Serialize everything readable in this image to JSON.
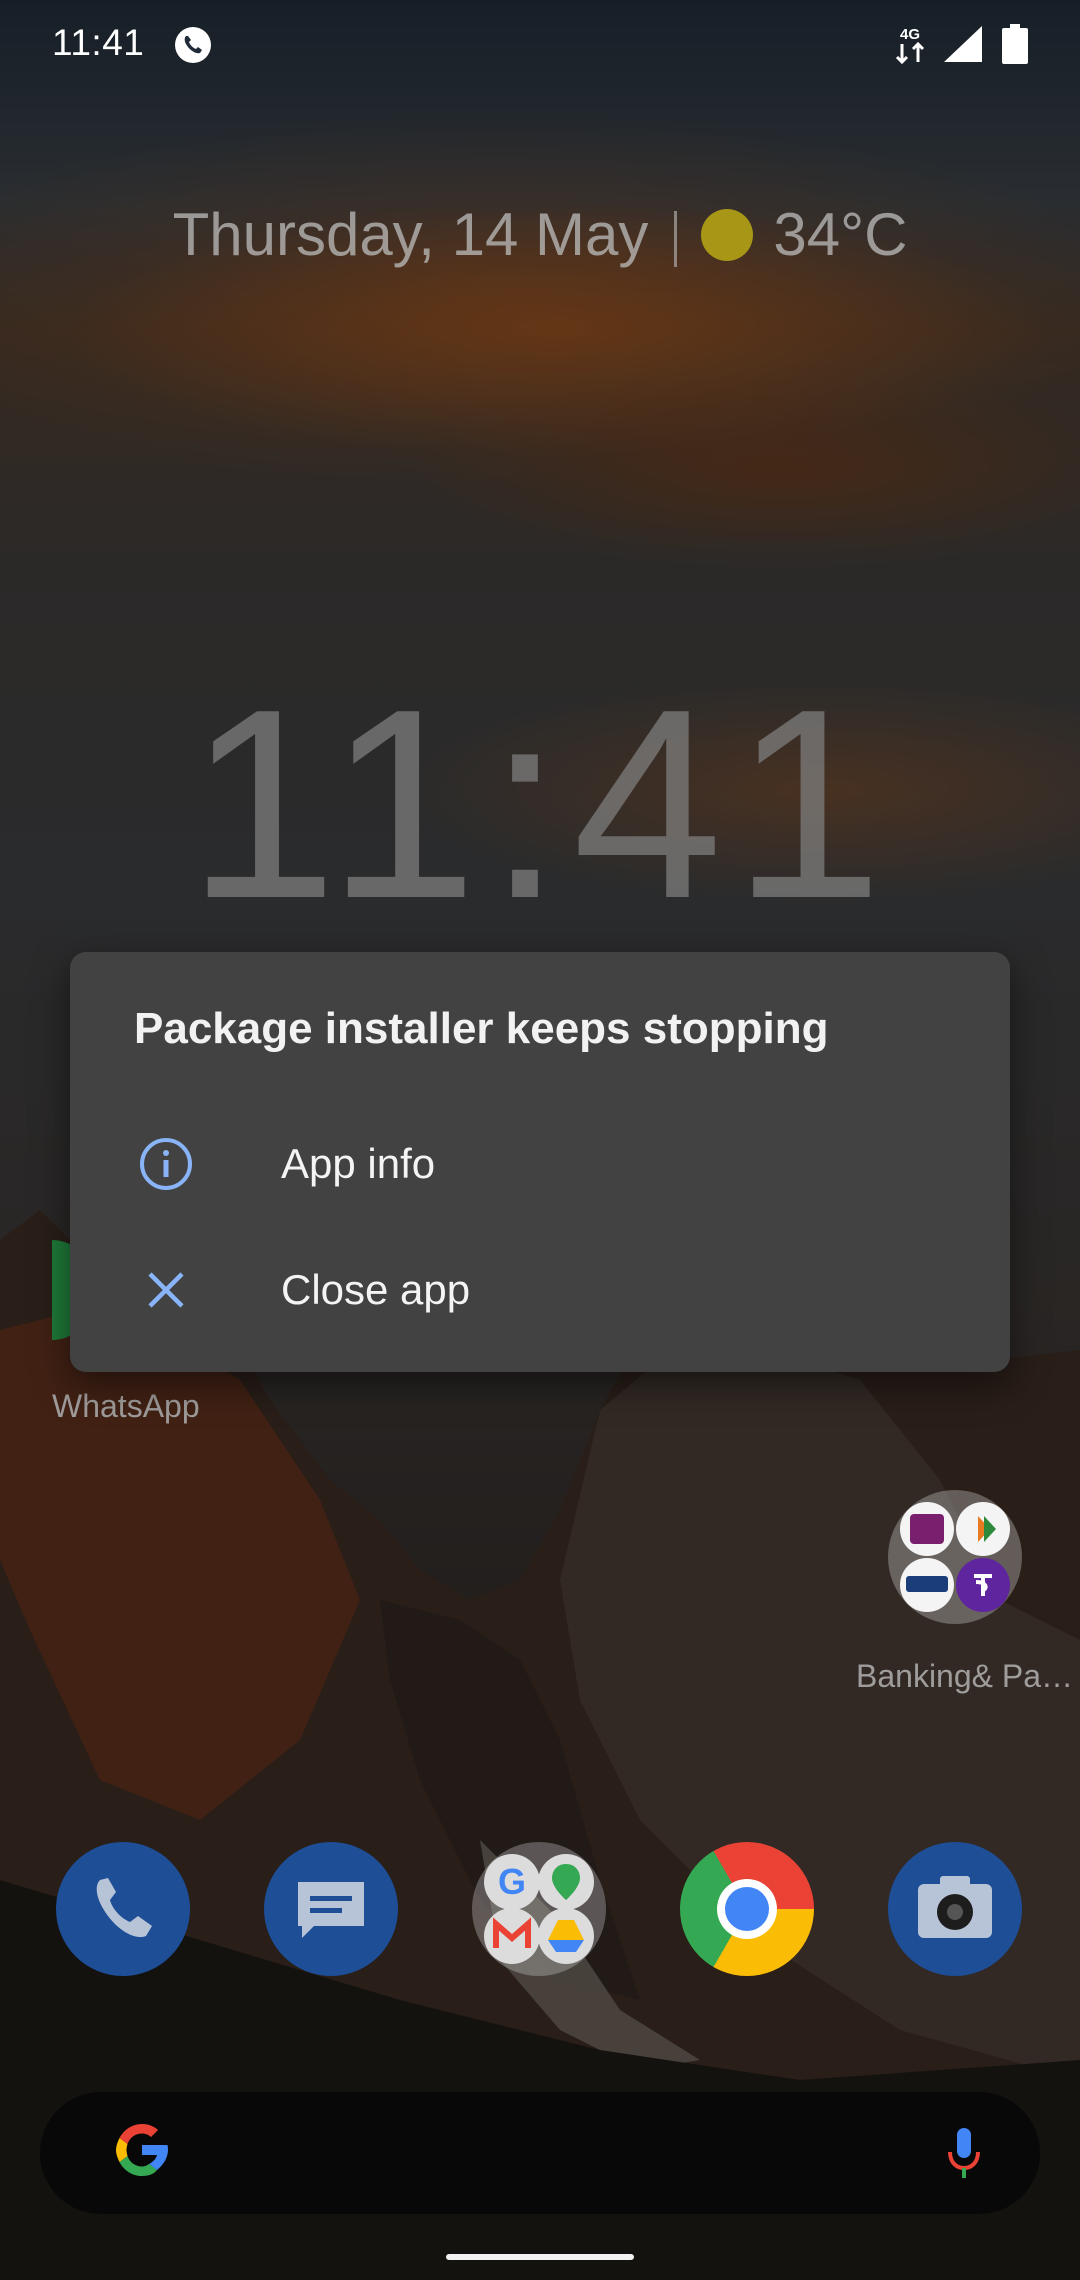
{
  "status_bar": {
    "time": "11:41",
    "network_label": "4G",
    "icons": [
      "call-icon",
      "network-4g-icon",
      "signal-icon",
      "battery-icon"
    ]
  },
  "lockscreen": {
    "date": "Thursday, 14 May",
    "temperature": "34°C",
    "weather_icon": "sun-icon",
    "clock": "11:41"
  },
  "dialog": {
    "title": "Package installer keeps stopping",
    "items": [
      {
        "label": "App info",
        "icon": "info-icon"
      },
      {
        "label": "Close app",
        "icon": "close-icon"
      }
    ],
    "accent_color": "#8ab4f8"
  },
  "home": {
    "apps": [
      {
        "label": "WhatsApp"
      },
      {
        "label": "Banking& Pa…"
      }
    ],
    "folder_apps": [
      "yono SBI",
      "BHIM",
      "Paytm",
      "PhonePe"
    ],
    "dock": [
      "Phone",
      "Messages",
      "Google folder",
      "Chrome",
      "Camera"
    ]
  },
  "search_bar": {
    "icons": [
      "google-g-icon",
      "mic-icon"
    ]
  }
}
